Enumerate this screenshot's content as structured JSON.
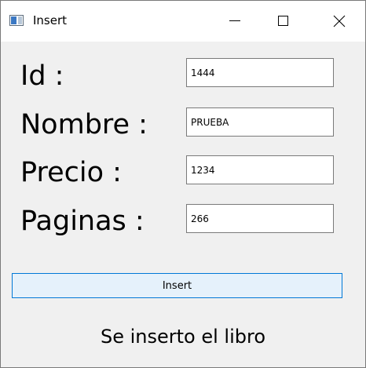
{
  "window": {
    "title": "Insert",
    "controls": {
      "minimize": "minimize-icon",
      "maximize": "maximize-icon",
      "close": "close-icon"
    }
  },
  "form": {
    "fields": [
      {
        "label": "Id :",
        "value": "1444"
      },
      {
        "label": "Nombre :",
        "value": "PRUEBA"
      },
      {
        "label": "Precio :",
        "value": "1234"
      },
      {
        "label": "Paginas :",
        "value": "266"
      }
    ],
    "insert_label": "Insert",
    "status_text": "Se inserto el libro"
  },
  "colors": {
    "window_bg": "#f0f0f0",
    "titlebar_bg": "#ffffff",
    "button_bg": "#e5f1fb",
    "button_border": "#0078d7",
    "field_border": "#7a7a7a"
  }
}
